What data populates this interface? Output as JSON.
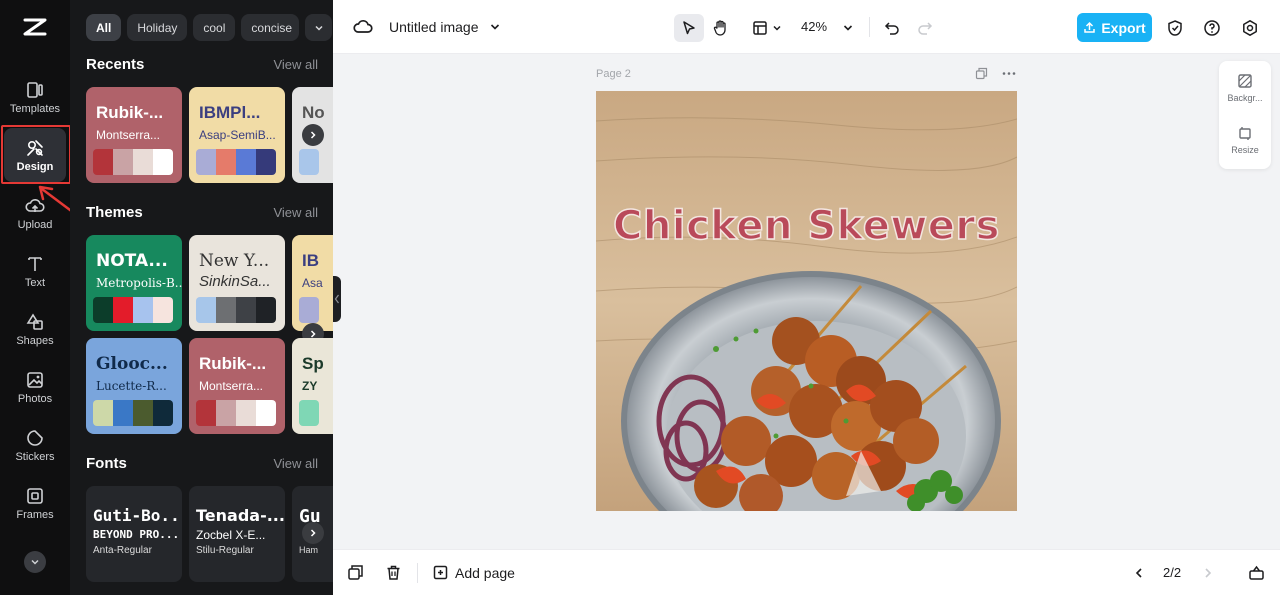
{
  "rail": {
    "items": [
      {
        "label": "Templates"
      },
      {
        "label": "Design"
      },
      {
        "label": "Upload"
      },
      {
        "label": "Text"
      },
      {
        "label": "Shapes"
      },
      {
        "label": "Photos"
      },
      {
        "label": "Stickers"
      },
      {
        "label": "Frames"
      }
    ],
    "active": "Design"
  },
  "panel": {
    "chips": [
      "All",
      "Holiday",
      "cool",
      "concise"
    ],
    "view_all": "View all",
    "recents": {
      "title": "Recents",
      "cards": [
        {
          "t1": "Rubik-...",
          "t2": "Montserra...",
          "bg": "#b0626a",
          "fg": "#ffffff",
          "swatches": [
            "#b3343a",
            "#c9a3a5",
            "#e9dcd7",
            "#ffffff"
          ]
        },
        {
          "t1": "IBMPl...",
          "t2": "Asap-SemiB...",
          "bg": "#f1dca6",
          "fg": "#3b3f80",
          "swatches": [
            "#a9acd6",
            "#e57b6a",
            "#5a7ad6",
            "#353a7a"
          ]
        },
        {
          "t1": "No",
          "t2": "",
          "bg": "#e3e3e3",
          "fg": "#555555",
          "swatches": [
            "#a9c6ea"
          ]
        }
      ]
    },
    "themes": {
      "title": "Themes",
      "cards": [
        {
          "t1": "NOTA...",
          "t2": "Metropolis-B...",
          "bg": "#17895e",
          "fg": "#ffffff",
          "swatches": [
            "#0c3d2a",
            "#e31c2a",
            "#a7c3ee",
            "#f6e4de"
          ]
        },
        {
          "t1": "New Y...",
          "t2": "SinkinSa...",
          "bg": "#e9e4dc",
          "fg": "#333333",
          "swatches": [
            "#a7c6ea",
            "#6d6f72",
            "#3e4146",
            "#1f2226"
          ]
        },
        {
          "t1": "IB",
          "t2": "Asa",
          "bg": "#f1dca6",
          "fg": "#3b3f80",
          "swatches": [
            "#a9acd6"
          ]
        },
        {
          "t1": "Glooc...",
          "t2": "Lucette-R...",
          "bg": "#7aa5dc",
          "fg": "#102a4a",
          "swatches": [
            "#cdd8a8",
            "#3a78c6",
            "#4b5b2e",
            "#0f2a3a"
          ]
        },
        {
          "t1": "Rubik-...",
          "t2": "Montserra...",
          "bg": "#b0626a",
          "fg": "#ffffff",
          "swatches": [
            "#b3343a",
            "#c9a3a5",
            "#e9dcd7",
            "#ffffff"
          ]
        },
        {
          "t1": "Sp",
          "t2": "ZY",
          "bg": "#eae6d8",
          "fg": "#1b3a2a",
          "swatches": [
            "#7fd7b5"
          ]
        }
      ]
    },
    "fonts": {
      "title": "Fonts",
      "cards": [
        {
          "f1": "Guti-Bo...",
          "f2": "BEYOND PRO...",
          "f3": "Anta-Regular"
        },
        {
          "f1": "Tenada-...",
          "f2": "Zocbel X-E...",
          "f3": "Stilu-Regular"
        },
        {
          "f1": "Gu",
          "f2": "",
          "f3": "Ham"
        }
      ]
    }
  },
  "topbar": {
    "title": "Untitled image",
    "zoom": "42%",
    "export": "Export"
  },
  "canvas": {
    "page_label": "Page 2",
    "headline": "Chicken Skewers"
  },
  "side_panel": {
    "background": "Backgr...",
    "resize": "Resize"
  },
  "bottombar": {
    "add_page": "Add page",
    "pager": "2/2"
  }
}
